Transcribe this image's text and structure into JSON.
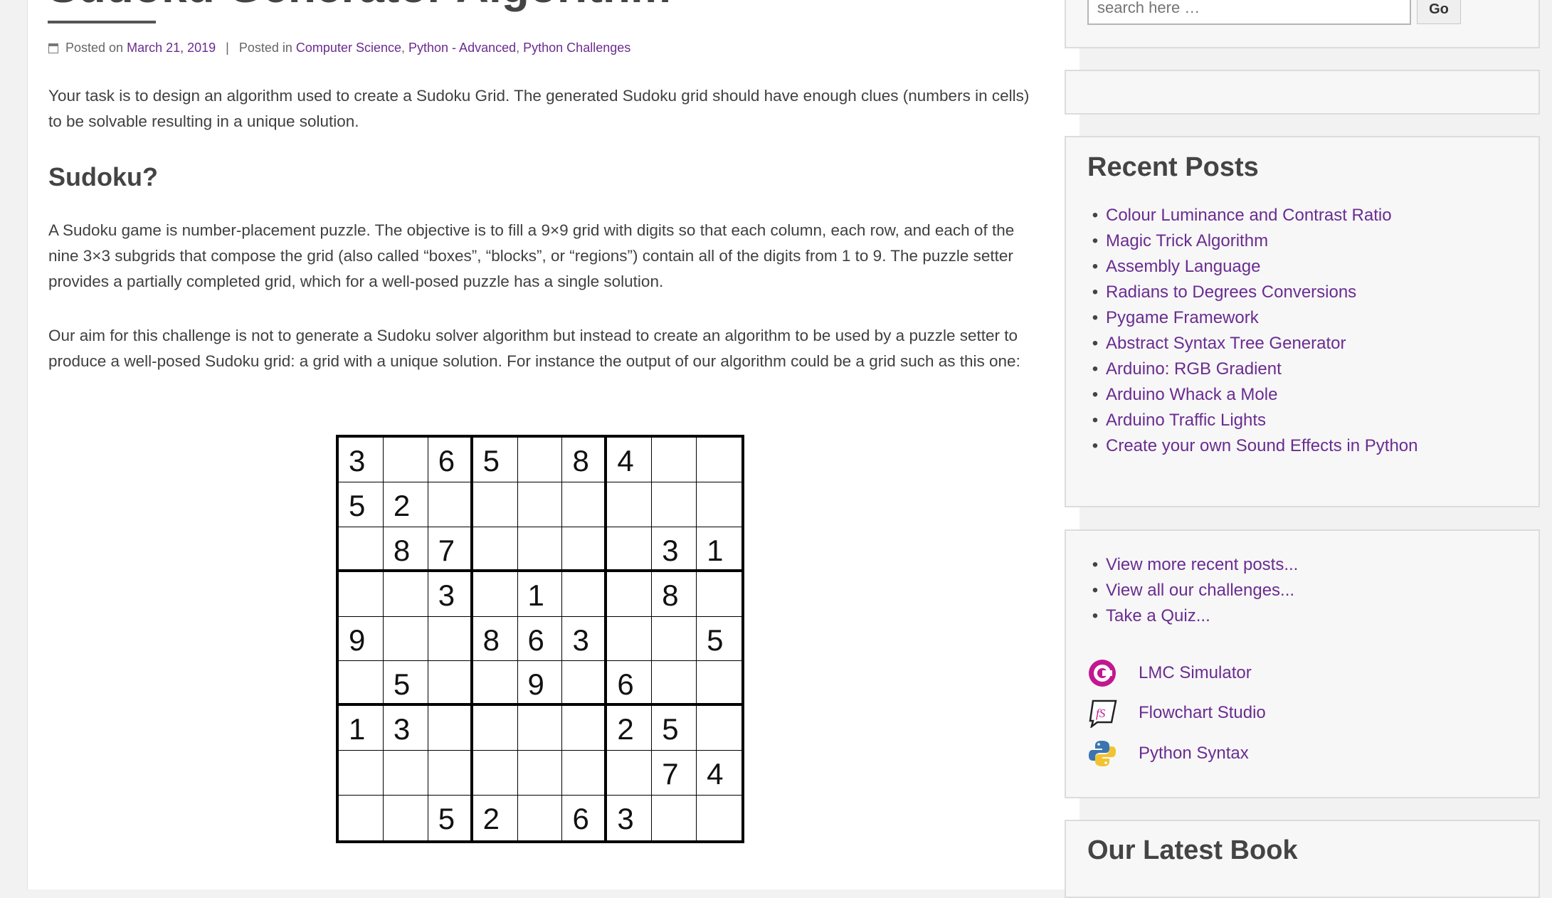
{
  "post": {
    "title": "Sudoku Generator Algorithm",
    "posted_on_label": "Posted on",
    "date": "March 21, 2019",
    "posted_in_label": "Posted in",
    "categories": [
      "Computer Science",
      "Python - Advanced",
      "Python Challenges"
    ],
    "intro": "Your task is to design an algorithm used to create a Sudoku Grid. The generated Sudoku grid should have enough clues (numbers in cells) to be solvable resulting in a unique solution.",
    "heading": "Sudoku?",
    "paragraph1": "A Sudoku game is number-placement puzzle. The objective is to fill a 9×9 grid with digits so that each column, each row, and each of the nine 3×3 subgrids that compose the grid (also called “boxes”, “blocks”, or “regions”) contain all of the digits from 1 to 9. The puzzle setter provides a partially completed grid, which for a well-posed puzzle has a single solution.",
    "paragraph2": "Our aim for this challenge is not to generate a Sudoku solver algorithm but instead to create an algorithm to be used by a puzzle setter to produce a well-posed Sudoku grid: a grid with a unique solution. For instance the output of our algorithm could be a grid such as this one:"
  },
  "sudoku": [
    [
      "3",
      "",
      "6",
      "5",
      "",
      "8",
      "4",
      "",
      ""
    ],
    [
      "5",
      "2",
      "",
      "",
      "",
      "",
      "",
      "",
      ""
    ],
    [
      "",
      "8",
      "7",
      "",
      "",
      "",
      "",
      "3",
      "1"
    ],
    [
      "",
      "",
      "3",
      "",
      "1",
      "",
      "",
      "8",
      ""
    ],
    [
      "9",
      "",
      "",
      "8",
      "6",
      "3",
      "",
      "",
      "5"
    ],
    [
      "",
      "5",
      "",
      "",
      "9",
      "",
      "6",
      "",
      ""
    ],
    [
      "1",
      "3",
      "",
      "",
      "",
      "",
      "2",
      "5",
      ""
    ],
    [
      "",
      "",
      "",
      "",
      "",
      "",
      "",
      "7",
      "4"
    ],
    [
      "",
      "",
      "5",
      "2",
      "",
      "6",
      "3",
      "",
      ""
    ]
  ],
  "sidebar": {
    "search": {
      "placeholder": "search here …",
      "button": "Go"
    },
    "recent_posts": {
      "title": "Recent Posts",
      "items": [
        "Colour Luminance and Contrast Ratio",
        "Magic Trick Algorithm",
        "Assembly Language",
        "Radians to Degrees Conversions",
        "Pygame Framework",
        "Abstract Syntax Tree Generator",
        "Arduino: RGB Gradient",
        "Arduino Whack a Mole",
        "Arduino Traffic Lights",
        "Create your own Sound Effects in Python"
      ]
    },
    "more_links": [
      "View more recent posts...",
      "View all our challenges...",
      "Take a Quiz..."
    ],
    "tools": [
      {
        "label": "LMC Simulator",
        "icon": "lmc-icon"
      },
      {
        "label": "Flowchart Studio",
        "icon": "flowchart-icon"
      },
      {
        "label": "Python Syntax",
        "icon": "python-icon"
      }
    ],
    "book_title": "Our Latest Book"
  },
  "colors": {
    "link": "#6a2c91",
    "text": "#404040",
    "widget_bg": "#f7f7f7"
  }
}
